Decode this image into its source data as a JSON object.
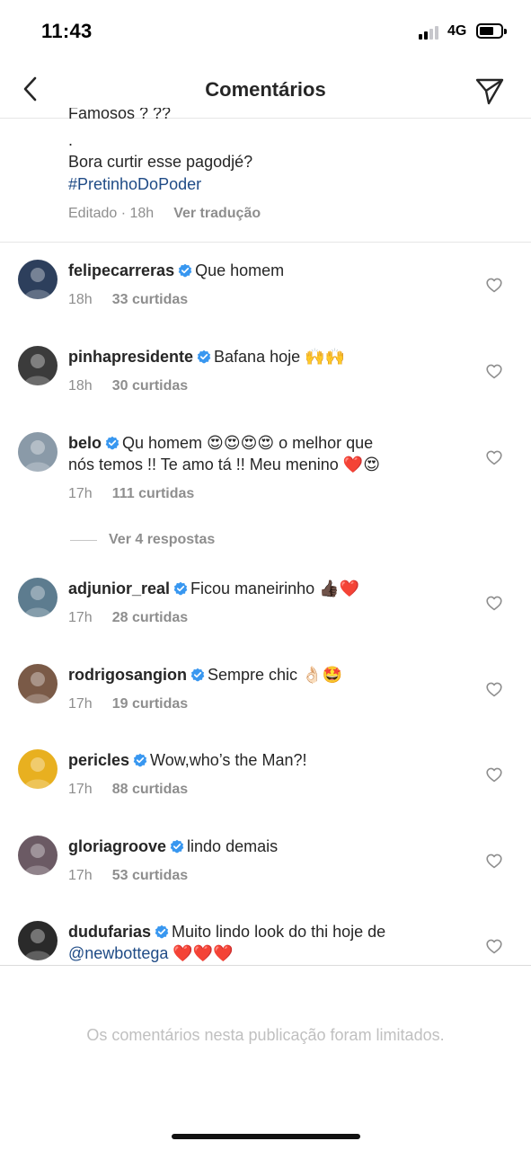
{
  "status_bar": {
    "time": "11:43",
    "network": "4G"
  },
  "header": {
    "title": "Comentários"
  },
  "caption": {
    "clipped_line": "Famosos ? ??",
    "dot": ".",
    "line": "Bora curtir esse pagodjé?",
    "hashtag": "#PretinhoDoPoder",
    "edited": "Editado · 18h",
    "translate": "Ver tradução"
  },
  "comments": [
    {
      "username": "felipecarreras",
      "text": "Que homem",
      "text2": "",
      "age": "18h",
      "likes": "33 curtidas",
      "avatar_color": "#2d3f5c"
    },
    {
      "username": "pinhapresidente",
      "text": "Bafana hoje 🙌🙌",
      "text2": "",
      "age": "18h",
      "likes": "30 curtidas",
      "avatar_color": "#3b3b3b"
    },
    {
      "username": "belo",
      "text": "Qu homem 😍😍😍😍 o melhor que",
      "text2": "nós temos !! Te amo tá !! Meu menino ❤️😍",
      "age": "17h",
      "likes": "111 curtidas",
      "avatar_color": "#8a9aa8"
    },
    {
      "username": "adjunior_real",
      "text": "Ficou maneirinho 👍🏿❤️",
      "text2": "",
      "age": "17h",
      "likes": "28 curtidas",
      "avatar_color": "#5d7c8f"
    },
    {
      "username": "rodrigosangion",
      "text": "Sempre chic 👌🏻🤩",
      "text2": "",
      "age": "17h",
      "likes": "19 curtidas",
      "avatar_color": "#7a5a47"
    },
    {
      "username": "pericles",
      "text": "Wow,who’s the Man?!",
      "text2": "",
      "age": "17h",
      "likes": "88 curtidas",
      "avatar_color": "#e8b020"
    },
    {
      "username": "gloriagroove",
      "text": "lindo demais",
      "text2": "",
      "age": "17h",
      "likes": "53 curtidas",
      "avatar_color": "#6b5a64"
    },
    {
      "username": "dudufarias",
      "text": "Muito lindo look do thi hoje de",
      "text2_mention": "@newbottega",
      "text2_tail": " ❤️❤️❤️",
      "age": "",
      "likes": "",
      "avatar_color": "#2a2a2a"
    }
  ],
  "replies_link": "Ver 4 respostas",
  "footer_notice": "Os comentários nesta publicação foram limitados.",
  "colors": {
    "link": "#1f4b86",
    "muted": "#8e8e8e",
    "verified": "#3897f0"
  }
}
